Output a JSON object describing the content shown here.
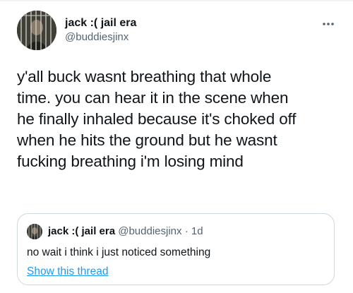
{
  "tweet": {
    "author": {
      "display_name": "jack :( jail era",
      "handle": "@buddiesjinx",
      "avatar_icon": "profile-photo"
    },
    "more_icon": "ellipsis-icon",
    "text_lines": [
      "y'all buck wasnt breathing that whole",
      "time. you can hear it in the scene when",
      "he finally inhaled because it's choked off",
      "when he hits the ground but he wasnt",
      "fucking breathing i'm losing mind"
    ]
  },
  "quoted_tweet": {
    "display_name": "jack :( jail era",
    "handle": "@buddiesjinx",
    "separator": "·",
    "time": "1d",
    "text": "no wait i think i just noticed something",
    "show_thread_label": "Show this thread"
  },
  "colors": {
    "text_primary": "#0f1419",
    "text_secondary": "#536471",
    "link": "#1d9bf0",
    "border": "#cfd9de"
  }
}
